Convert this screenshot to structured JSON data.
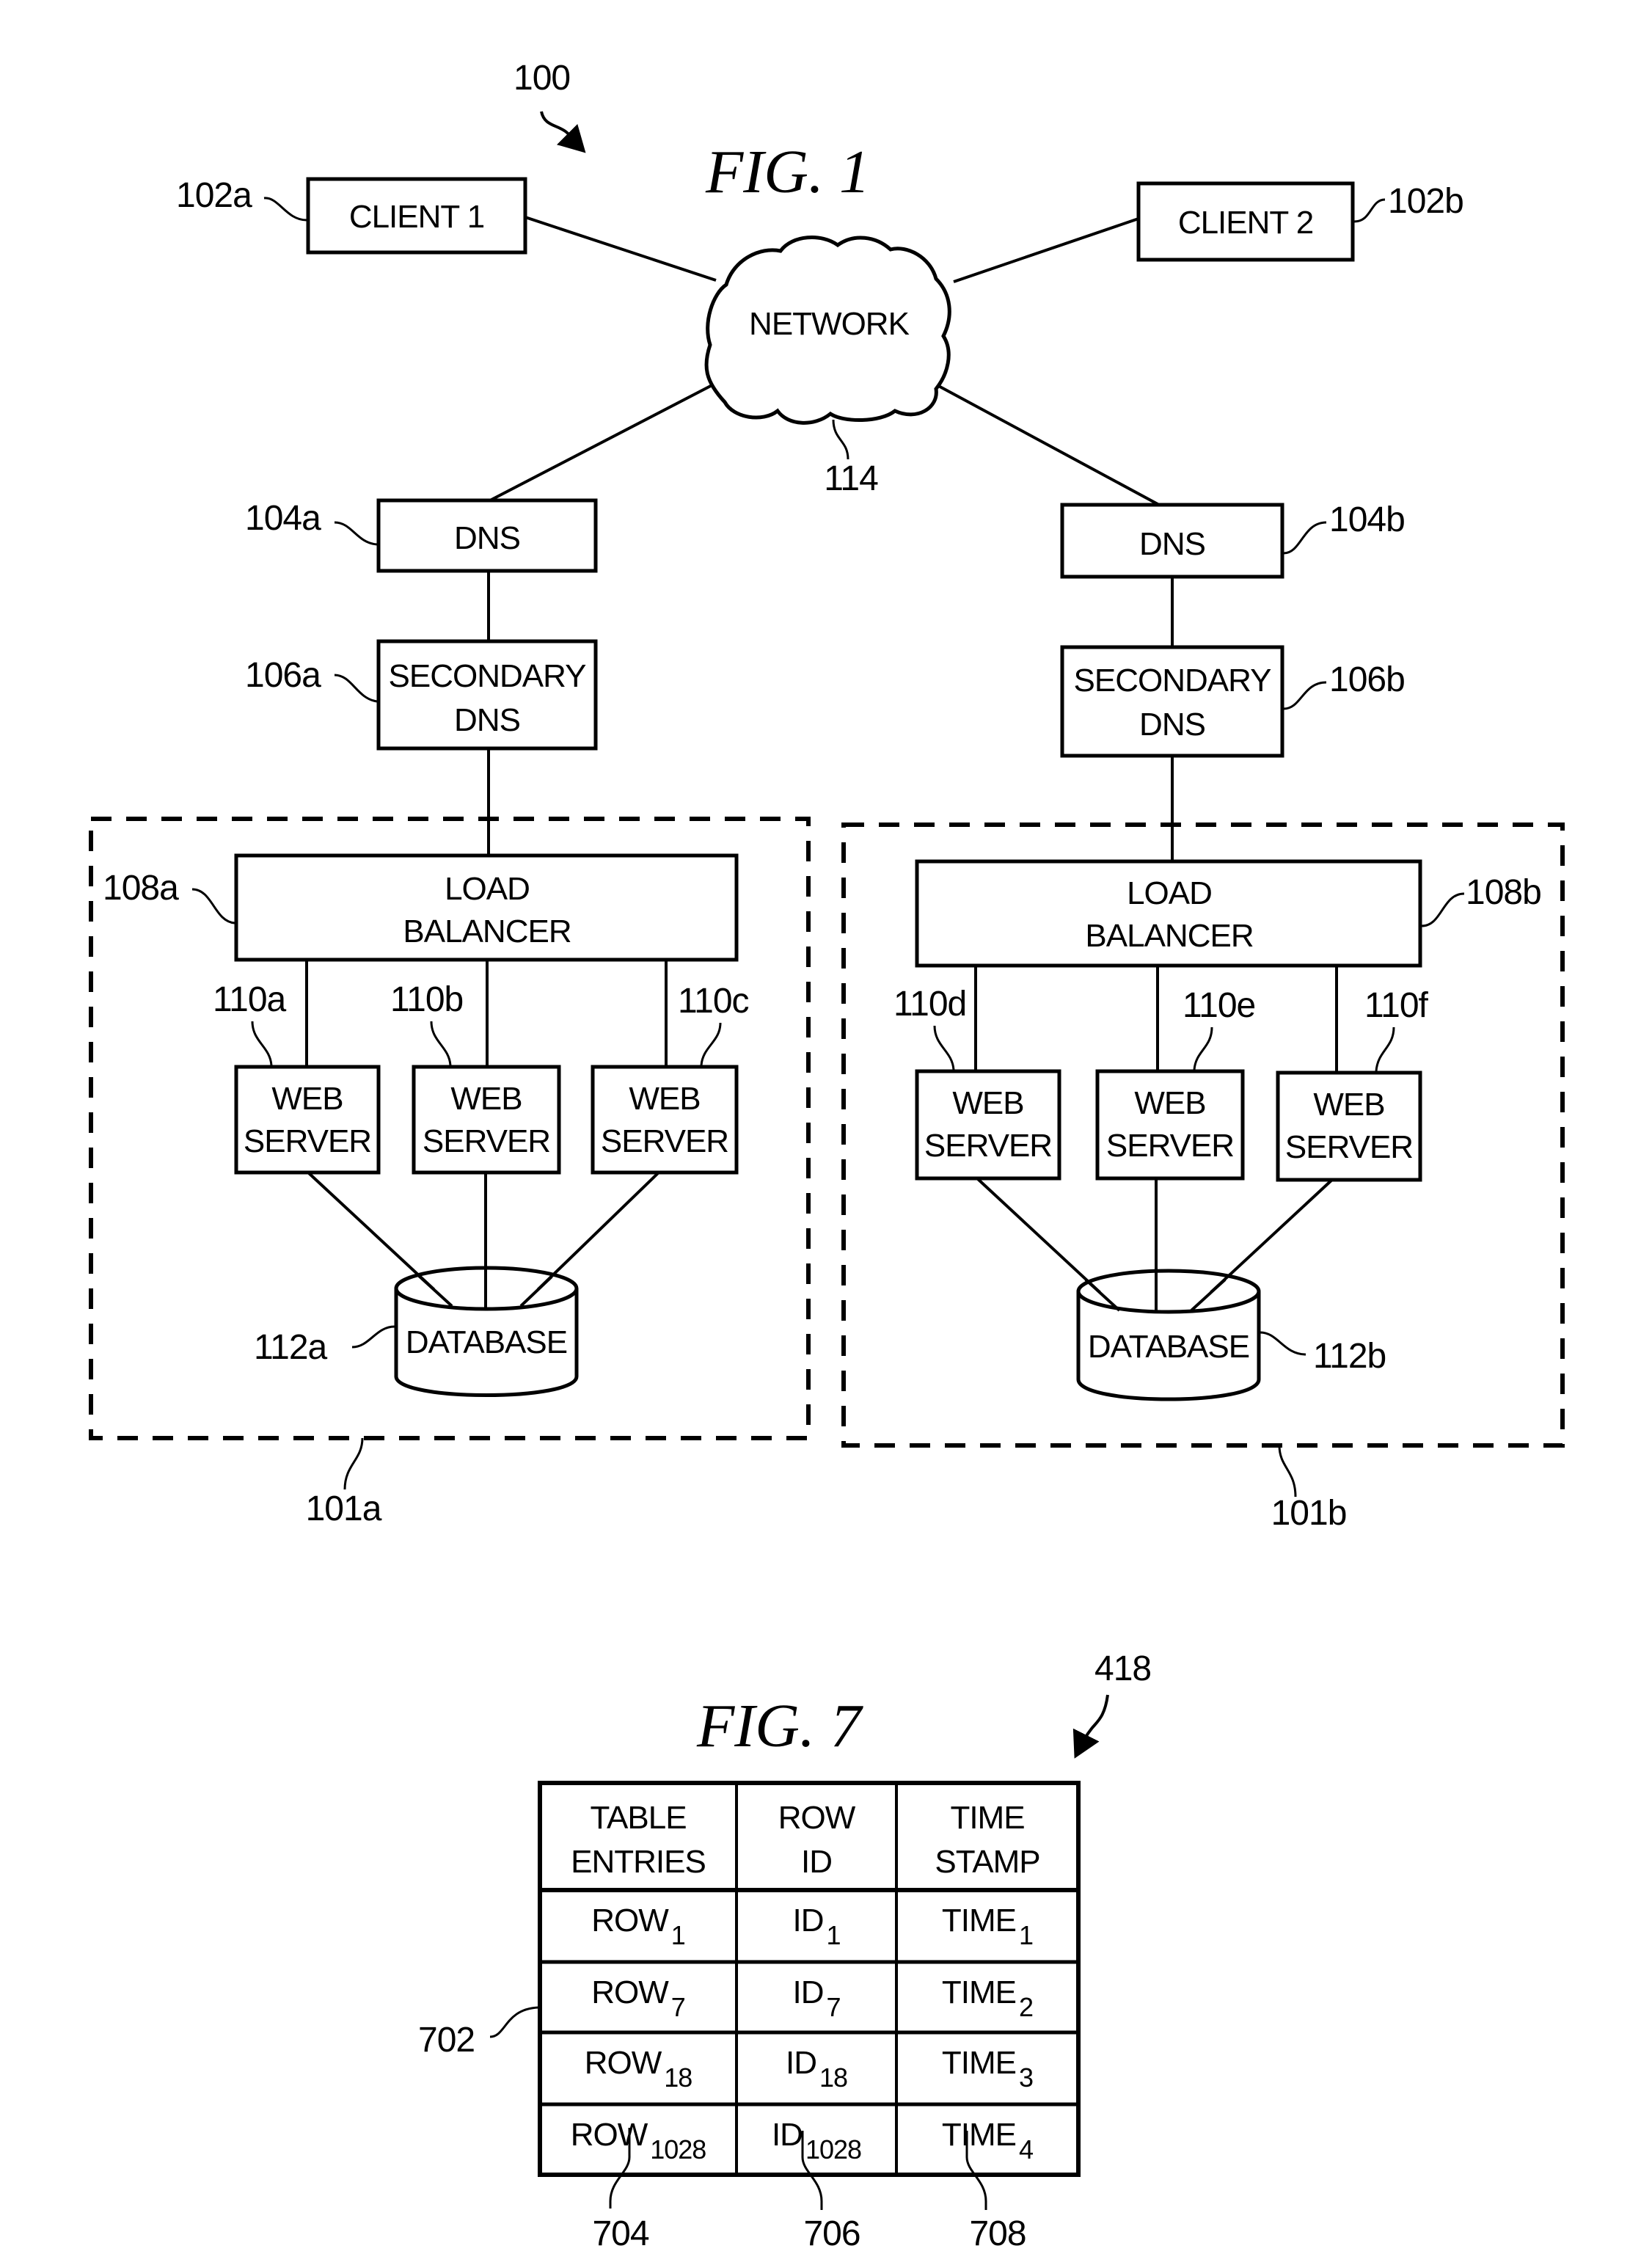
{
  "figure1": {
    "title": "FIG.  1",
    "system_ref": "100",
    "network": {
      "label": "NETWORK",
      "ref": "114"
    },
    "clients": [
      {
        "label": "CLIENT  1",
        "ref": "102a"
      },
      {
        "label": "CLIENT  2",
        "ref": "102b"
      }
    ],
    "sites": [
      {
        "ref": "101a",
        "dns": {
          "label": "DNS",
          "ref": "104a"
        },
        "secondary_dns": {
          "line1": "SECONDARY",
          "line2": "DNS",
          "ref": "106a"
        },
        "load_balancer": {
          "line1": "LOAD",
          "line2": "BALANCER",
          "ref": "108a"
        },
        "web_servers": [
          {
            "line1": "WEB",
            "line2": "SERVER",
            "ref": "110a"
          },
          {
            "line1": "WEB",
            "line2": "SERVER",
            "ref": "110b"
          },
          {
            "line1": "WEB",
            "line2": "SERVER",
            "ref": "110c"
          }
        ],
        "database": {
          "label": "DATABASE",
          "ref": "112a"
        }
      },
      {
        "ref": "101b",
        "dns": {
          "label": "DNS",
          "ref": "104b"
        },
        "secondary_dns": {
          "line1": "SECONDARY",
          "line2": "DNS",
          "ref": "106b"
        },
        "load_balancer": {
          "line1": "LOAD",
          "line2": "BALANCER",
          "ref": "108b"
        },
        "web_servers": [
          {
            "line1": "WEB",
            "line2": "SERVER",
            "ref": "110d"
          },
          {
            "line1": "WEB",
            "line2": "SERVER",
            "ref": "110e"
          },
          {
            "line1": "WEB",
            "line2": "SERVER",
            "ref": "110f"
          }
        ],
        "database": {
          "label": "DATABASE",
          "ref": "112b"
        }
      }
    ]
  },
  "figure7": {
    "title": "FIG.  7",
    "table_ref": "418",
    "rows_ref": "702",
    "column_refs": [
      "704",
      "706",
      "708"
    ],
    "headers": [
      {
        "line1": "TABLE",
        "line2": "ENTRIES"
      },
      {
        "line1": "ROW",
        "line2": "ID"
      },
      {
        "line1": "TIME",
        "line2": "STAMP"
      }
    ],
    "rows": [
      [
        {
          "base": "ROW",
          "sub": "1"
        },
        {
          "base": "ID",
          "sub": "1"
        },
        {
          "base": "TIME",
          "sub": "1"
        }
      ],
      [
        {
          "base": "ROW",
          "sub": "7"
        },
        {
          "base": "ID",
          "sub": "7"
        },
        {
          "base": "TIME",
          "sub": "2"
        }
      ],
      [
        {
          "base": "ROW",
          "sub": "18"
        },
        {
          "base": "ID",
          "sub": "18"
        },
        {
          "base": "TIME",
          "sub": "3"
        }
      ],
      [
        {
          "base": "ROW",
          "sub": "1028"
        },
        {
          "base": "ID",
          "sub": "1028"
        },
        {
          "base": "TIME",
          "sub": "4"
        }
      ]
    ]
  }
}
